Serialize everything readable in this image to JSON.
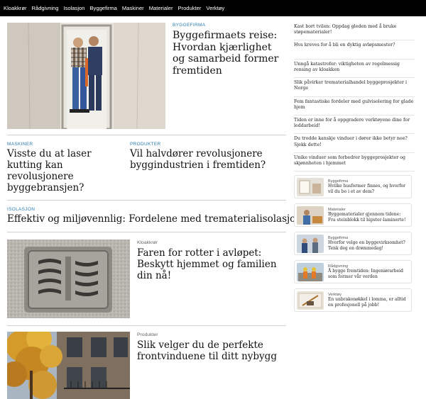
{
  "nav": [
    "Kloakkrør",
    "Rådgivning",
    "Isolasjon",
    "Byggefirma",
    "Maskiner",
    "Materialer",
    "Produkter",
    "Verktøy"
  ],
  "hero": {
    "category": "BYGGEFIRMA",
    "title": "Byggefirmaets reise: Hvordan kjærlighet og samarbeid former fremtiden"
  },
  "mid_left": {
    "category": "MASKINER",
    "title": "Visste du at laser kutting kan revolusjonere byggebransjen?"
  },
  "mid_right": {
    "category": "PRODUKTER",
    "title": "Vil halvdører revolusjonere byggindustrien i fremtiden?"
  },
  "isolasjon": {
    "category": "ISOLASJON",
    "title": "Effektiv og miljøvennlig: Fordelene med trematerialisolasjon"
  },
  "story1": {
    "category": "Kloakkrør",
    "title": "Faren for rotter i avløpet: Beskytt hjemmet og familien din nå!"
  },
  "story2": {
    "category": "Produkter",
    "title": "Slik velger du de perfekte frontvinduene til ditt nybygg"
  },
  "sidebar_list": [
    "Kast bort tvilen: Oppdag gleden med å bruke støpematerialer!",
    "Hva kreves for å bli en dyktig avløpsmester?",
    "Unngå katastrofer: viktigheten av regelmessig rensing av kloakken",
    "Slik påvirker trematerialhandel byggeprosjekter i Norge",
    "Fem fantastiske fordeler med gulvisolering for glade hjem",
    "Tiden er inne for å oppgradere verktøyene dine for leddarbeid!",
    "Du trodde kanskje vinduer i dører ikke betyr noe? Sjekk dette!",
    "Unike vinduer som forbedrer byggeprosjekter og skjønnheten i hjemmet"
  ],
  "cards": [
    {
      "category": "Byggefirma",
      "title": "Hvilke husformer finnes, og hvorfor vil du bo i et av dem?"
    },
    {
      "category": "Materialer",
      "title": "Byggematerialer gjennom tidene: Fra steinblokk til hipster-laminerte!"
    },
    {
      "category": "Byggefirma",
      "title": "Hvorfor velge en byggevirksomhet? Tenk deg en drømmedag!"
    },
    {
      "category": "Rådgivning",
      "title": "Å bygge fremtiden: Ingeniørarbeid som former vår verden"
    },
    {
      "category": "Verktøy",
      "title": "En unbrakonøkkel i lomma, er alltid en profesjonell på jobb!"
    }
  ]
}
